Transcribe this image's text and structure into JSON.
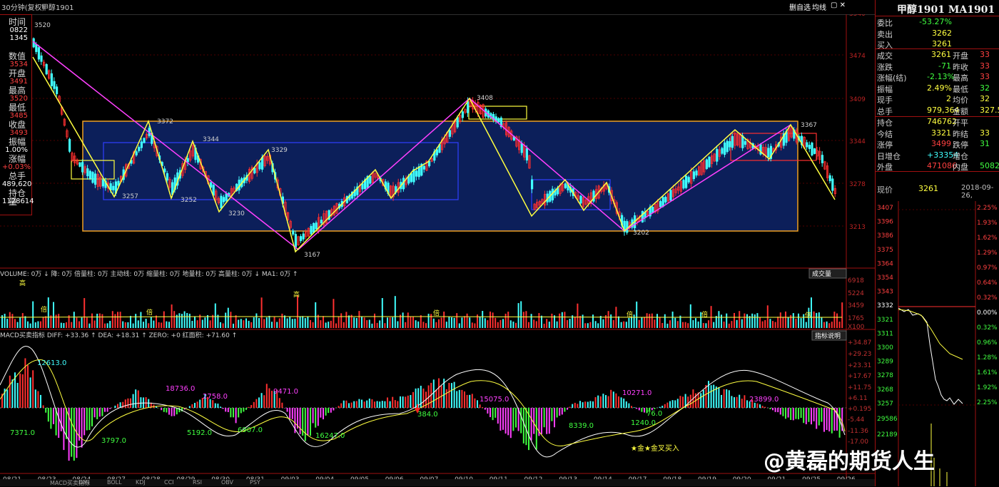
{
  "topbar": {
    "tabs": [
      "30分钟(复权)",
      "甲醇1901"
    ],
    "chart_buttons": [
      "删自选",
      "均线"
    ]
  },
  "left_panel": {
    "items": [
      {
        "label": "时间",
        "value": "0822",
        "color": "#ffffff"
      },
      {
        "label": "",
        "value": "1345",
        "color": "#ffffff"
      },
      {
        "label": "数值",
        "value": "3534",
        "color": "#ff4040"
      },
      {
        "label": "开盘",
        "value": "3491",
        "color": "#ff4040"
      },
      {
        "label": "最高",
        "value": "3520",
        "color": "#ff4040"
      },
      {
        "label": "最低",
        "value": "3485",
        "color": "#ff4040"
      },
      {
        "label": "收盘",
        "value": "3493",
        "color": "#ff4040"
      },
      {
        "label": "振幅",
        "value": "1.00%",
        "color": "#ffffff"
      },
      {
        "label": "涨幅",
        "value": "+0.03%",
        "color": "#ff4040"
      },
      {
        "label": "总手",
        "value": "489,620",
        "color": "#ffffff"
      },
      {
        "label": "持仓量",
        "value": "1128614",
        "color": "#ffffff"
      }
    ]
  },
  "price_axis": [
    "3540",
    "3474",
    "3409",
    "3344",
    "3278",
    "3213"
  ],
  "price_annotations": [
    "3520",
    "3372",
    "3344",
    "3329",
    "3257",
    "3252",
    "3230",
    "3167",
    "3408",
    "3367",
    "3202"
  ],
  "volume_header": "VOLUME: 0万 ↓ 降: 0万 倍量柱: 0万 主动线: 0万 缩量柱: 0万 地量柱: 0万 高量柱: 0万 ↓ MA1: 0万 ↑",
  "volume_button": "成交量",
  "volume_axis": [
    "6918",
    "5224",
    "3459",
    "1765",
    "X100"
  ],
  "volume_markers": [
    "高",
    "倍",
    "高",
    "倍",
    "倍",
    "倍",
    "倍",
    "倍"
  ],
  "macd_header": "MACD买卖指标  DIFF: +33.36 ↑  DEA: +18.31 ↑  ZERO: +0  红面积: +71.60 ↑",
  "macd_button": "指标说明",
  "macd_axis": [
    "+34.87",
    "+29.23",
    "+23.31",
    "+17.67",
    "+11.75",
    "+6.11",
    "+0.195",
    "-5.44",
    "-11.36",
    "-17.00"
  ],
  "macd_labels": [
    "12613.0",
    "7371.0",
    "3797.0",
    "18736.0",
    "2758.0",
    "5192.0",
    "6907.0",
    "9471.0",
    "16247.0",
    "384.0",
    "15075.0",
    "8339.0",
    "10271.0",
    "1240.0",
    "76.0",
    "23899.0"
  ],
  "signal_text": "★金★金叉买入",
  "date_axis": [
    "08/21",
    "08/23",
    "08/24",
    "08/27",
    "08/28",
    "08/29",
    "08/30",
    "08/31",
    "09/03",
    "09/04",
    "09/05",
    "09/06",
    "09/07",
    "09/10",
    "09/11",
    "09/12",
    "09/13",
    "09/14",
    "09/17",
    "09/18",
    "09/19",
    "09/20",
    "09/21",
    "09/25",
    "09/26"
  ],
  "right_panel": {
    "title": "甲醇1901 MA1901",
    "rows1": [
      {
        "l": "委比",
        "v": "-53.27%",
        "vc": "#40ff40"
      },
      {
        "l": "卖出",
        "v": "3262",
        "vc": "#ffff40"
      },
      {
        "l": "买入",
        "v": "3261",
        "vc": "#ffff40"
      }
    ],
    "rows2": [
      {
        "l": "成交",
        "v": "3261",
        "vc": "#ffff40",
        "l2": "开盘",
        "v2": "33",
        "v2c": "#ff4040"
      },
      {
        "l": "涨跌",
        "v": "-71",
        "vc": "#40ff40",
        "l2": "昨收",
        "v2": "33",
        "v2c": "#ff4040"
      },
      {
        "l": "涨幅(结)",
        "v": "-2.13%",
        "vc": "#40ff40",
        "l2": "最高",
        "v2": "33",
        "v2c": "#ff4040"
      },
      {
        "l": "振幅",
        "v": "2.49%",
        "vc": "#ffff40",
        "l2": "最低",
        "v2": "32",
        "v2c": "#40ff40"
      },
      {
        "l": "现手",
        "v": "2",
        "vc": "#ffff40",
        "l2": "均价",
        "v2": "32",
        "v2c": "#ffff40"
      },
      {
        "l": "总手",
        "v": "979,364",
        "vc": "#ffff40",
        "l2": "金额",
        "v2": "327.5",
        "v2c": "#ffff40"
      }
    ],
    "rows3": [
      {
        "l": "持仓",
        "v": "746762",
        "vc": "#ffff40",
        "l2": "开平",
        "v2": "",
        "v2c": "#ffff40"
      },
      {
        "l": "今结",
        "v": "3321",
        "vc": "#ffff40",
        "l2": "昨结",
        "v2": "33",
        "v2c": "#ffff40"
      },
      {
        "l": "涨停",
        "v": "3499",
        "vc": "#ff4040",
        "l2": "跌停",
        "v2": "31",
        "v2c": "#40ff40"
      },
      {
        "l": "日增仓",
        "v": "+33354",
        "vc": "#40ffff",
        "l2": "增仓",
        "v2": "",
        "v2c": "#ffff40"
      },
      {
        "l": "外盘",
        "v": "471086",
        "vc": "#ff4040",
        "l2": "内盘",
        "v2": "5082",
        "v2c": "#40ff40"
      }
    ],
    "quote": {
      "label": "现价",
      "price": "3261",
      "date": "2018-09-26,"
    },
    "mini_left_axis": [
      "3407",
      "3396",
      "3386",
      "3375",
      "3364",
      "3354",
      "3343",
      "3332",
      "3321",
      "3311",
      "3300",
      "3289",
      "3278",
      "3268",
      "3257",
      "29586",
      "22189"
    ],
    "mini_right_axis": [
      "2.25%",
      "1.93%",
      "1.62%",
      "1.29%",
      "0.97%",
      "0.64%",
      "0.32%",
      "0.00%",
      "0.32%",
      "0.96%",
      "1.28%",
      "1.61%",
      "1.92%",
      "2.25%"
    ]
  },
  "watermark": "@黄磊的期货人生",
  "bottom_tabs": [
    "MACD买卖指标",
    "DMI",
    "BOLL",
    "KDJ",
    "CCI",
    "RSI",
    "OBV",
    "PSY"
  ]
}
